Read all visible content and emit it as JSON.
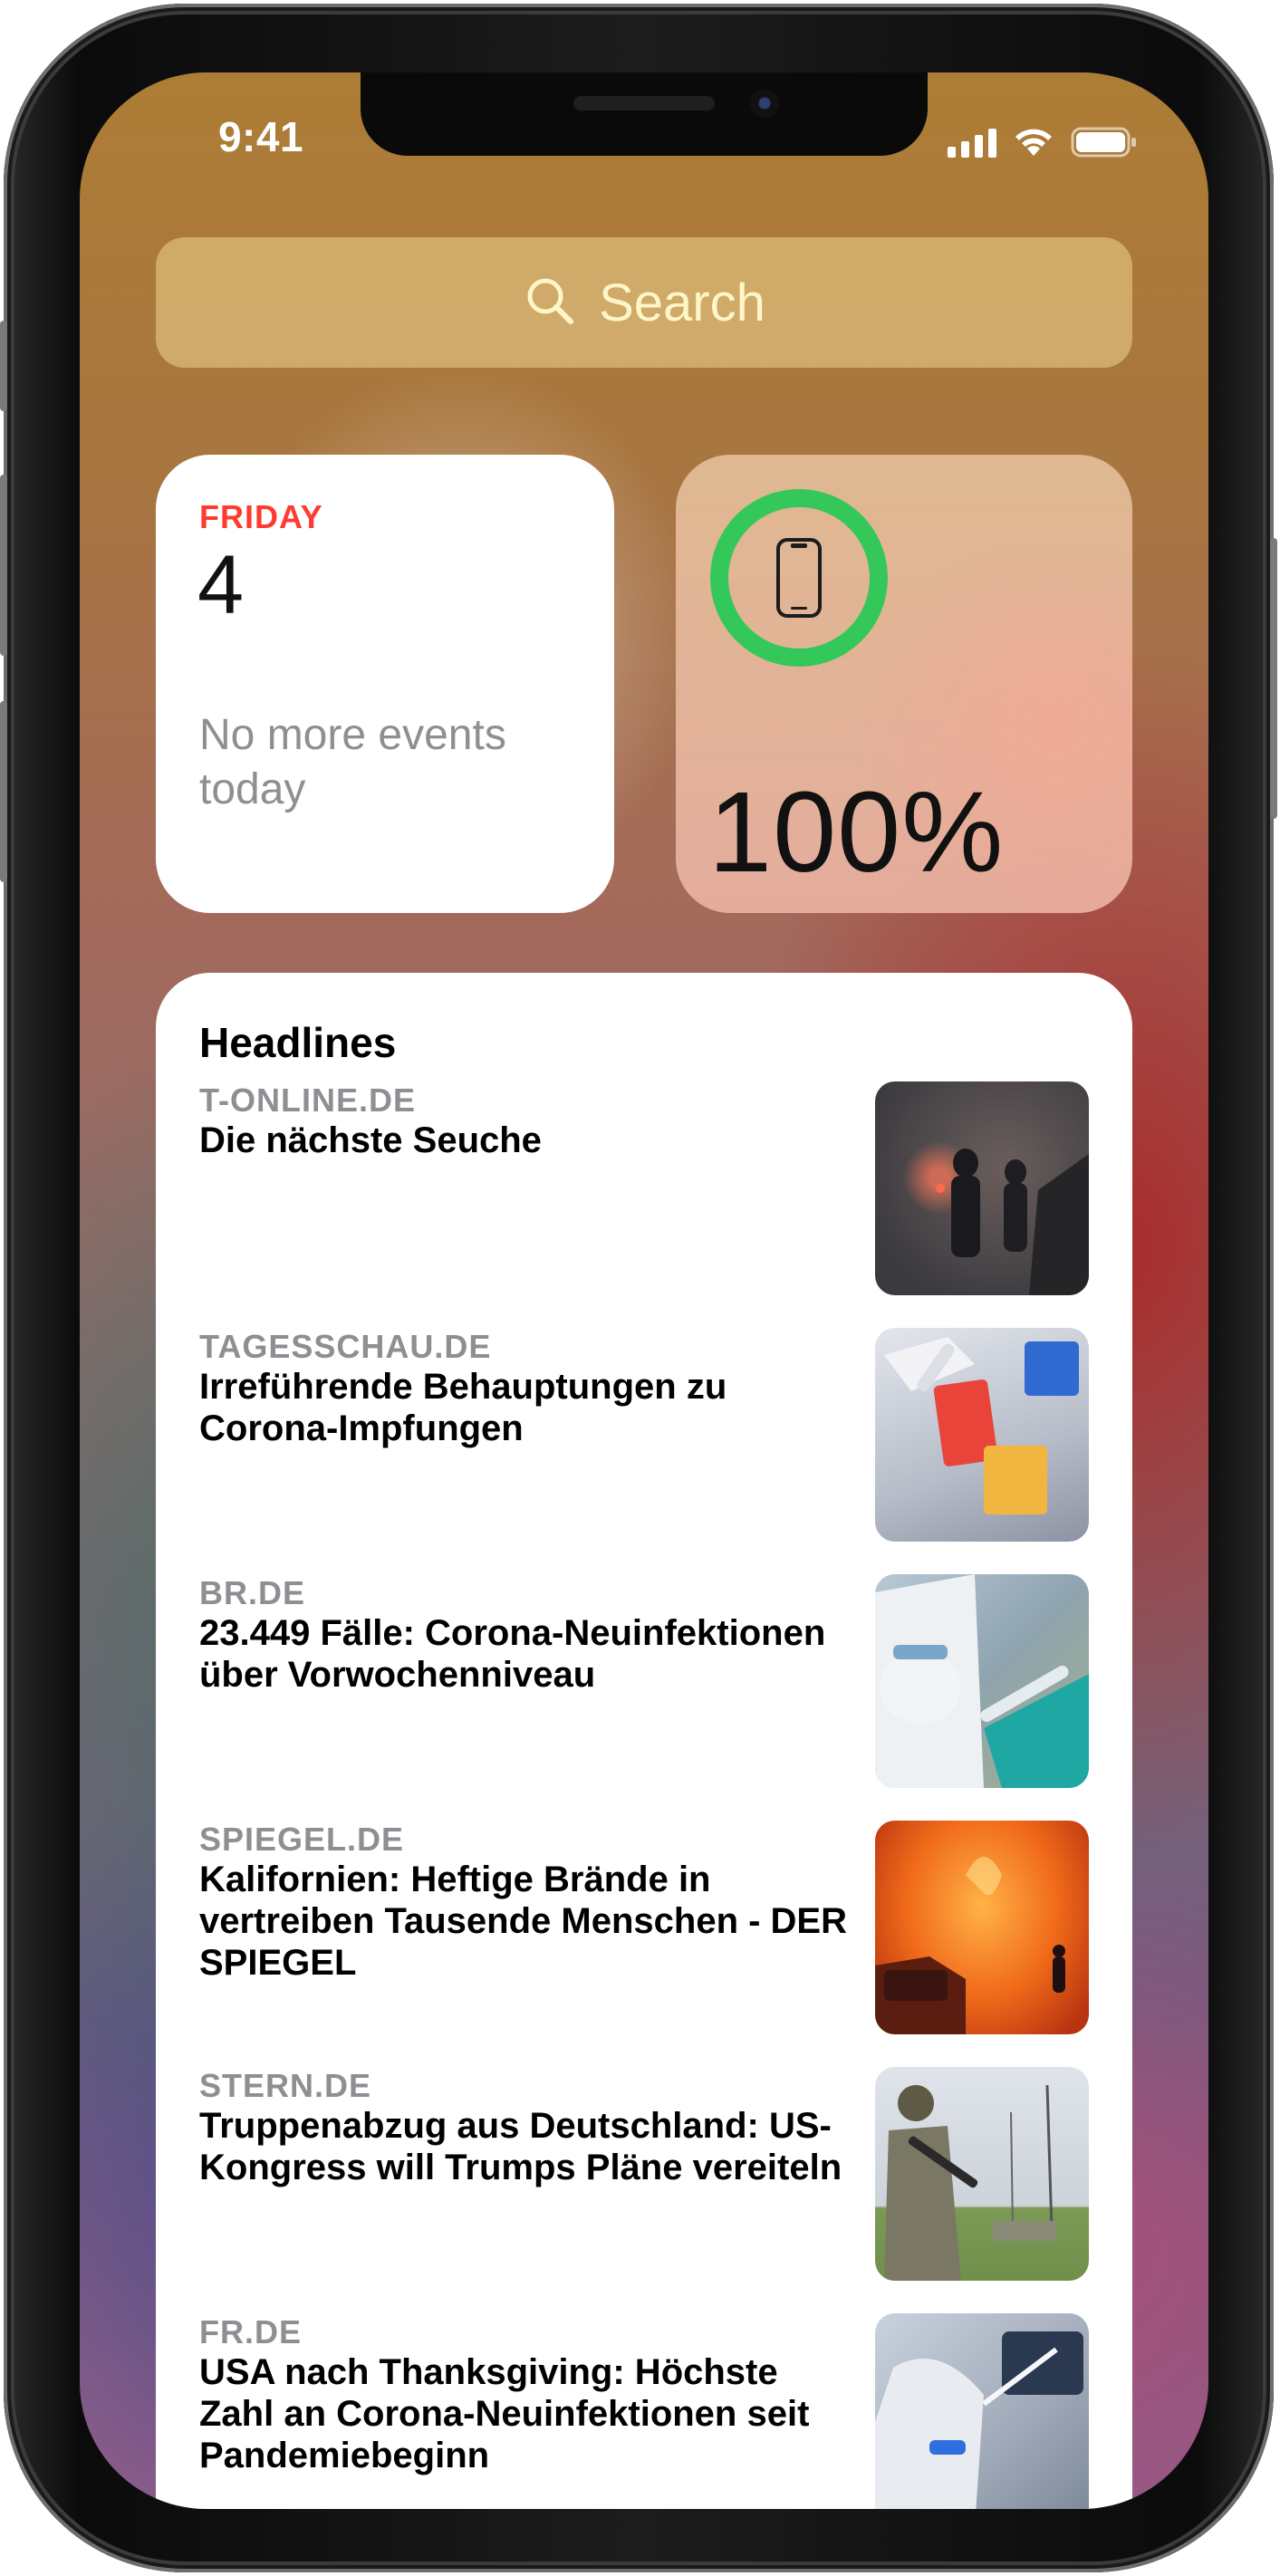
{
  "status_bar": {
    "time": "9:41"
  },
  "search": {
    "label": "Search",
    "icon": "search-icon"
  },
  "calendar_widget": {
    "weekday": "FRIDAY",
    "day": "4",
    "events_text": "No more events today",
    "accent_color": "#ff3b30"
  },
  "battery_widget": {
    "percent_text": "100%",
    "level": 1.0,
    "ring_color": "#34c759",
    "icon": "iphone-icon"
  },
  "headlines_widget": {
    "title": "Headlines",
    "items": [
      {
        "source": "T-ONLINE.DE",
        "headline": "Die nächste Seuche",
        "thumbnail": "foggy-road-figures-image"
      },
      {
        "source": "TAGESSCHAU.DE",
        "headline": "Irreführende Behauptungen zu Corona-Impfungen",
        "thumbnail": "lab-pipette-image"
      },
      {
        "source": "BR.DE",
        "headline": "23.449 Fälle: Corona-Neuinfektionen über Vorwochenniveau",
        "thumbnail": "vaccine-syringe-image"
      },
      {
        "source": "SPIEGEL.DE",
        "headline": "Kalifornien: Heftige Brände in vertreiben Tausende Menschen - DER SPIEGEL",
        "thumbnail": "wildfire-image"
      },
      {
        "source": "STERN.DE",
        "headline": "Truppenabzug aus Deutschland: US-Kongress will Trumps Pläne vereiteln",
        "thumbnail": "soldier-image"
      },
      {
        "source": "FR.DE",
        "headline": "USA nach Thanksgiving: Höchste Zahl an Corona-Neuinfektionen seit Pandemiebeginn",
        "thumbnail": "hospital-image"
      }
    ]
  }
}
